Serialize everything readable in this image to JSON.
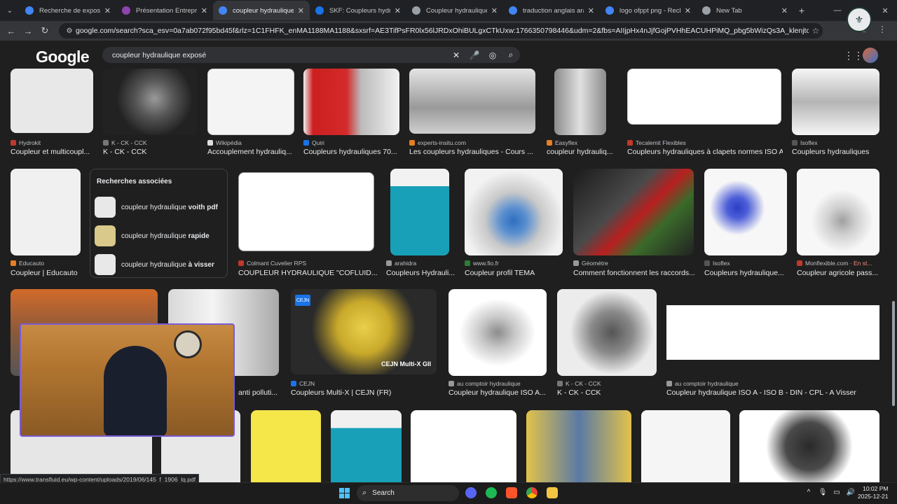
{
  "tabs": [
    {
      "label": "Recherche de expose p",
      "color": "#4285f4",
      "active": false
    },
    {
      "label": "Présentation Entreprise",
      "color": "#8e44ad",
      "active": false
    },
    {
      "label": "coupleur hydraulique ex",
      "color": "#4285f4",
      "active": true
    },
    {
      "label": "SKF: Coupleurs hydrauli",
      "color": "#1a73e8",
      "active": false
    },
    {
      "label": "Coupleur hydraulique d",
      "color": "#9aa0a6",
      "active": false
    },
    {
      "label": "traduction anglais arab",
      "color": "#4285f4",
      "active": false
    },
    {
      "label": "logo ofppt png - Reche",
      "color": "#4285f4",
      "active": false
    },
    {
      "label": "New Tab",
      "color": "#9aa0a6",
      "active": false
    }
  ],
  "address_bar": {
    "url": "google.com/search?sca_esv=0a7ab072f95bd45f&rlz=1C1FHFK_enMA1188MA1188&sxsrf=AE3TifPsFR0lx56lJRDxOhiBULgxCTkUxw:1766350798446&udm=2&fbs=AIIjpHx4nJjfGojPVHhEACUHPiMQ_pbg5bWizQs3A_klenjtcpTTqBUdyVgzq0c3_..."
  },
  "google": {
    "logo": "Google",
    "query": "coupleur hydraulique exposé"
  },
  "results_row1": [
    {
      "source": "Hydrokit",
      "title": "Coupleur et multicoupl...",
      "color": "#e8e8e8"
    },
    {
      "source": "K - CK - CCK",
      "title": "K - CK - CCK",
      "color": "#2a2a2a"
    },
    {
      "source": "Wikipédia",
      "title": "Accouplement hydrauliq...",
      "color": "#f4f4f4"
    },
    {
      "source": "Quiri",
      "title": "Coupleurs hydrauliques 70...",
      "color": "#f2f2f2"
    },
    {
      "source": "experts-insitu.com",
      "title": "Les coupleurs hydrauliques - Cours ...",
      "color": "#d9d9d9"
    },
    {
      "source": "Easyflex",
      "title": "coupleur hydrauliq...",
      "color": "#ececec"
    },
    {
      "source": "Tecalemit Flexibles",
      "title": "Coupleurs hydrauliques à clapets normes ISO A",
      "color": "#ffffff"
    },
    {
      "source": "Isoflex",
      "title": "Coupleurs hydrauliques",
      "color": "#f6f6f6"
    }
  ],
  "related": {
    "heading": "Recherches associées",
    "items": [
      {
        "prefix": "coupleur hydraulique ",
        "bold": "voith pdf"
      },
      {
        "prefix": "coupleur hydraulique ",
        "bold": "rapide"
      },
      {
        "prefix": "coupleur hydraulique ",
        "bold": "à visser"
      }
    ]
  },
  "results_row2": [
    {
      "source": "Educauto",
      "title": "Coupleur | Educauto",
      "color": "#f0f0f0"
    },
    {
      "source": "Colmant Cuvelier RPS",
      "title": "COUPLEUR HYDRAULIQUE \"COFLUID...",
      "color": "#ffffff"
    },
    {
      "source": "arahidra",
      "title": "Coupleurs Hydrauli...",
      "color": "#18a0b8"
    },
    {
      "source": "www.fio.fr",
      "title": "Coupleur profil TEMA",
      "color": "#f2f2f2"
    },
    {
      "source": "Géométre",
      "title": "Comment fonctionnent les raccords...",
      "color": "#2b2b2b"
    },
    {
      "source": "Isoflex",
      "title": "Coupleurs hydraulique...",
      "color": "#f7f7f7"
    },
    {
      "source": "Monflexible.com",
      "extra": "En st...",
      "title": "Coupleur agricole pass...",
      "color": "#f7f7f7"
    }
  ],
  "results_row3": [
    {
      "source": "",
      "title": "anti polluti...",
      "color": "#d8d8d8"
    },
    {
      "source": "CEJN",
      "title": "Coupleurs Multi-X | CEJN (FR)",
      "color": "#2a2a2a",
      "label": "CEJN Multi-X GII"
    },
    {
      "source": "au comptoir hydraulique",
      "title": "Coupleur hydraulique ISO A...",
      "color": "#ffffff"
    },
    {
      "source": "K - CK - CCK",
      "title": "K - CK - CCK",
      "color": "#ececec"
    },
    {
      "source": "au comptoir hydraulique",
      "title": "Coupleur hydraulique ISO A - ISO B - DIN - CPL - A Visser",
      "color": "#ffffff"
    }
  ],
  "results_row4_colors": [
    "#e6e6e6",
    "#e8e8e8",
    "#f5e64a",
    "#f0f0f0",
    "#ffffff",
    "#e2c24a",
    "#f5f5f5",
    "#ffffff"
  ],
  "status_url": "https://www.transfluid.eu/wp-content/uploads/2019/06/145_f_1906_lq.pdf",
  "taskbar": {
    "search_label": "Search",
    "time": "10:02 PM",
    "date": "2025-12-21"
  }
}
